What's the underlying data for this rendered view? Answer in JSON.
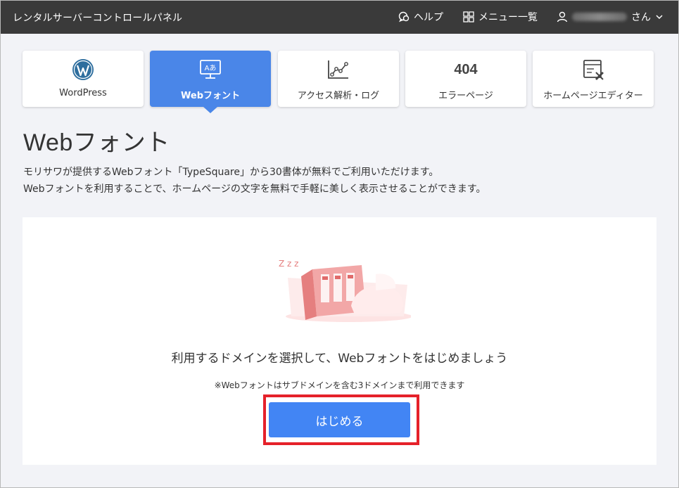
{
  "header": {
    "app_title": "レンタルサーバーコントロールパネル",
    "help_label": "ヘルプ",
    "menu_label": "メニュー一覧",
    "user_suffix": "さん"
  },
  "tabs": [
    {
      "label": "WordPress",
      "icon": "wordpress-icon",
      "active": false
    },
    {
      "label": "Webフォント",
      "icon": "webfont-icon",
      "active": true
    },
    {
      "label": "アクセス解析・ログ",
      "icon": "analytics-chart-icon",
      "active": false
    },
    {
      "label": "エラーページ",
      "icon_text": "404",
      "active": false
    },
    {
      "label": "ホームページエディター",
      "icon": "editor-icon",
      "active": false
    }
  ],
  "page": {
    "title": "Webフォント",
    "desc_line1": "モリサワが提供するWebフォント「TypeSquare」から30書体が無料でご利用いただけます。",
    "desc_line2": "Webフォントを利用することで、ホームページの文字を無料で手軽に美しく表示させることができます。"
  },
  "panel": {
    "illustration_text": "Z z z",
    "lead": "利用するドメインを選択して、Webフォントをはじめましょう",
    "note": "※Webフォントはサブドメインを含む3ドメインまで利用できます",
    "start_button": "はじめる"
  },
  "colors": {
    "topbar": "#3a3a3a",
    "accent": "#4285f4",
    "highlight": "#e5212a",
    "background": "#f2f3f7"
  }
}
